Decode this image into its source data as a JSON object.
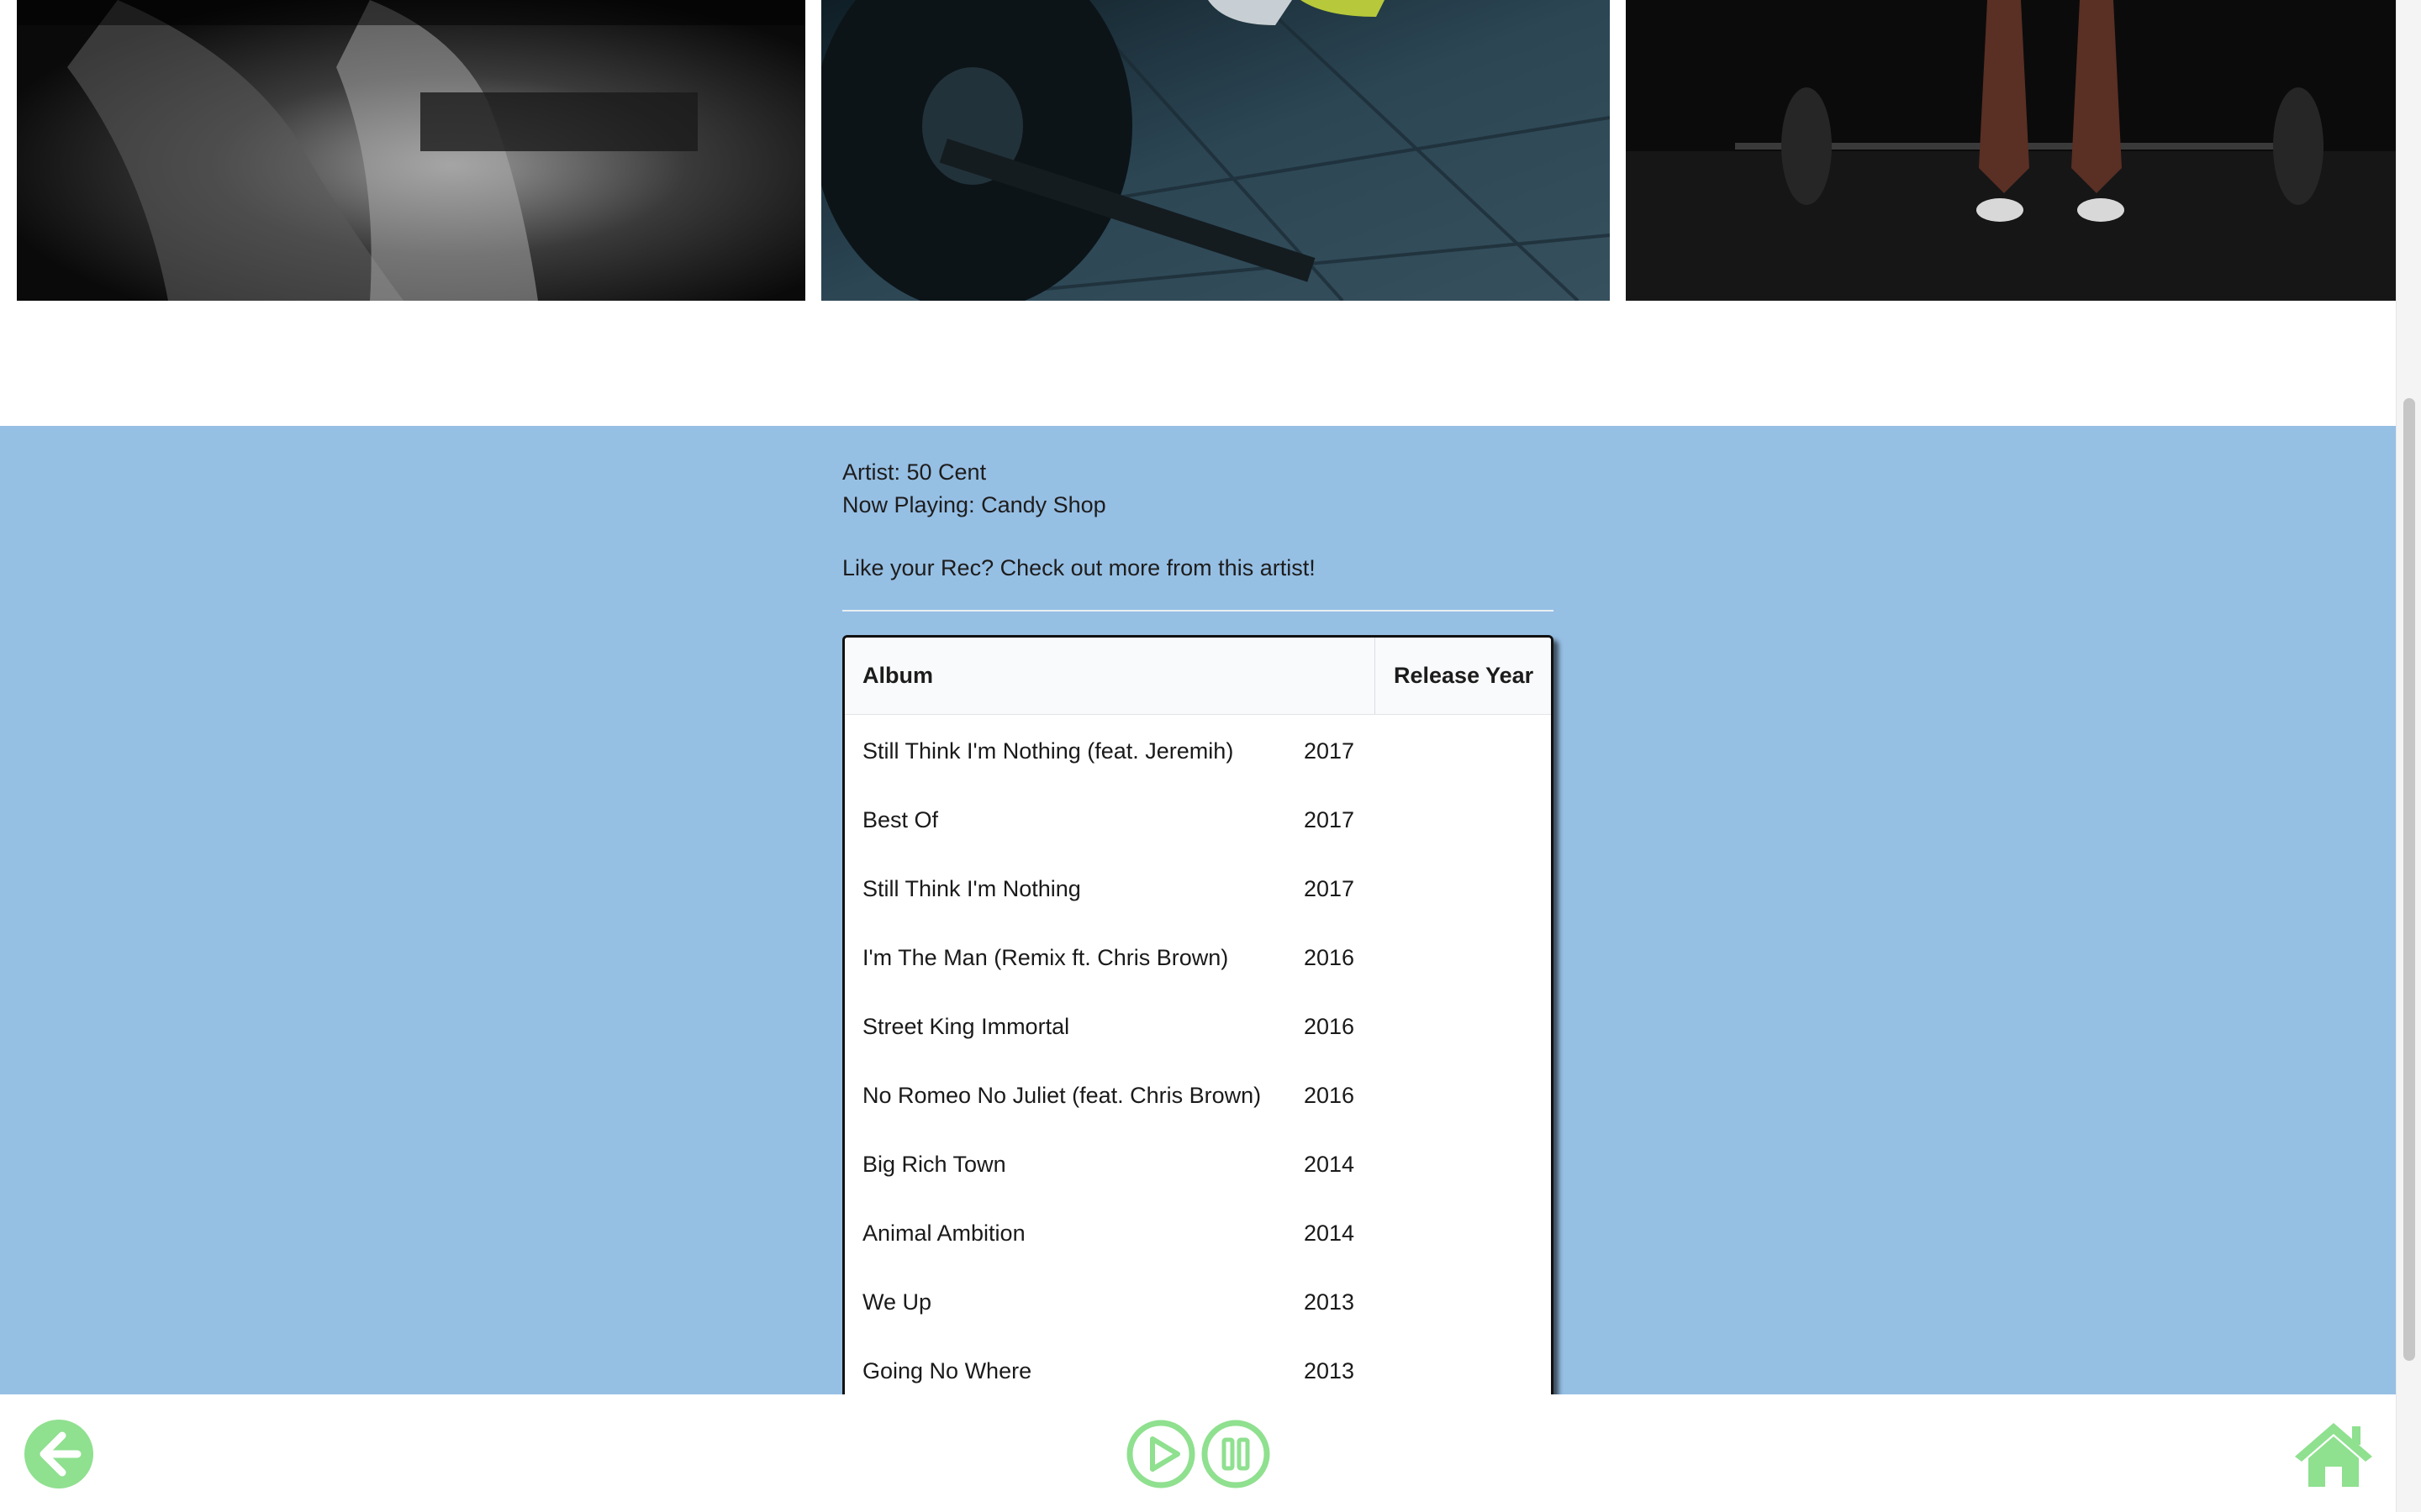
{
  "colors": {
    "section_bg": "#96bfe4",
    "accent_green": "#8fe08f",
    "table_header_bg": "#f9fafb"
  },
  "gallery": {
    "images": [
      {
        "name": "fitness-photo-woman-back"
      },
      {
        "name": "fitness-photo-barbell-floor"
      },
      {
        "name": "fitness-photo-deadlift"
      }
    ]
  },
  "now_playing": {
    "artist_line": "Artist: 50 Cent",
    "song_line": "Now Playing: Candy Shop",
    "rec_line": "Like your Rec? Check out more from this artist!"
  },
  "albums_table": {
    "headers": {
      "album": "Album",
      "year": "Release Year"
    },
    "rows": [
      {
        "album": "Still Think I'm Nothing (feat. Jeremih)",
        "year": "2017"
      },
      {
        "album": "Best Of",
        "year": "2017"
      },
      {
        "album": "Still Think I'm Nothing",
        "year": "2017"
      },
      {
        "album": "I'm The Man (Remix ft. Chris Brown)",
        "year": "2016"
      },
      {
        "album": "Street King Immortal",
        "year": "2016"
      },
      {
        "album": "No Romeo No Juliet (feat. Chris Brown)",
        "year": "2016"
      },
      {
        "album": "Big Rich Town",
        "year": "2014"
      },
      {
        "album": "Animal Ambition",
        "year": "2014"
      },
      {
        "album": "We Up",
        "year": "2013"
      },
      {
        "album": "Going No Where",
        "year": "2013"
      }
    ]
  },
  "controls": {
    "back_icon": "arrow-left-circle-icon",
    "play_icon": "play-circle-icon",
    "pause_icon": "pause-circle-icon",
    "home_icon": "home-icon"
  }
}
